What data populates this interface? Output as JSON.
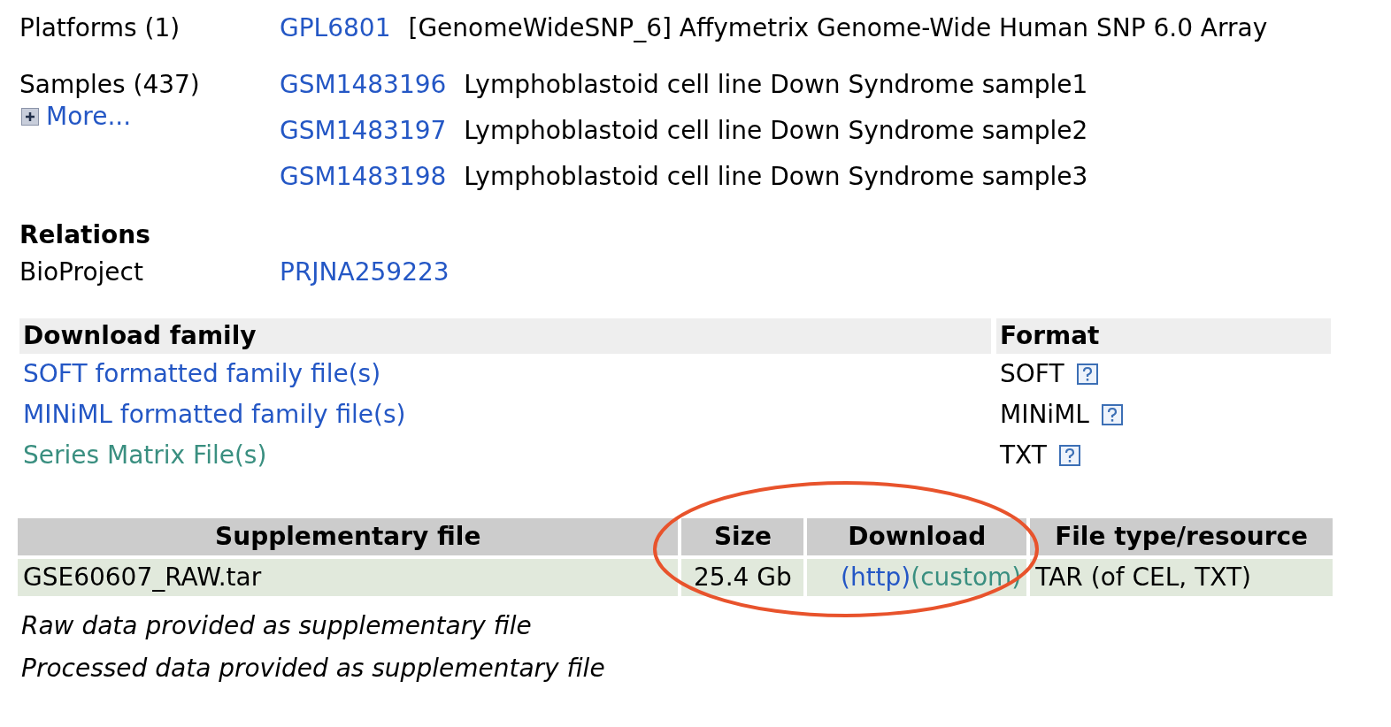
{
  "platforms": {
    "label": "Platforms (1)",
    "items": [
      {
        "id": "GPL6801",
        "description": "[GenomeWideSNP_6] Affymetrix Genome-Wide Human SNP 6.0 Array"
      }
    ]
  },
  "samples": {
    "label": "Samples (437)",
    "more": "More...",
    "items": [
      {
        "id": "GSM1483196",
        "description": "Lymphoblastoid cell line Down Syndrome sample1"
      },
      {
        "id": "GSM1483197",
        "description": "Lymphoblastoid cell line Down Syndrome sample2"
      },
      {
        "id": "GSM1483198",
        "description": "Lymphoblastoid cell line Down Syndrome sample3"
      }
    ]
  },
  "relations": {
    "heading": "Relations",
    "items": [
      {
        "label": "BioProject",
        "value": "PRJNA259223"
      }
    ]
  },
  "download_family": {
    "columns": [
      "Download family",
      "Format"
    ],
    "rows": [
      {
        "name": "SOFT formatted family file(s)",
        "visited": false,
        "format": "SOFT"
      },
      {
        "name": "MINiML formatted family file(s)",
        "visited": false,
        "format": "MINiML"
      },
      {
        "name": "Series Matrix File(s)",
        "visited": true,
        "format": "TXT"
      }
    ]
  },
  "supplementary": {
    "columns": [
      "Supplementary file",
      "Size",
      "Download",
      "File type/resource"
    ],
    "rows": [
      {
        "file": "GSE60607_RAW.tar",
        "size": "25.4 Gb",
        "downloads": [
          {
            "label": "(http)",
            "visited": false
          },
          {
            "label": "(custom)",
            "visited": true
          }
        ],
        "type": "TAR (of CEL, TXT)"
      }
    ],
    "notes": [
      "Raw data provided as supplementary file",
      "Processed data provided as supplementary file"
    ]
  }
}
